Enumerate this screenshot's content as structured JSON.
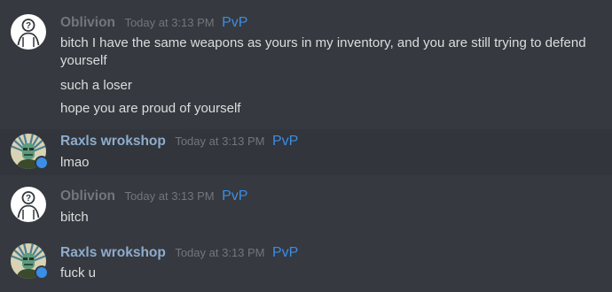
{
  "colors": {
    "background": "#36393f",
    "highlight_row": "#32353b",
    "username_oblivion": "#72767d",
    "username_raxls": "#8eaccd",
    "timestamp": "#72767d",
    "tag": "#3a8ee6",
    "message_text": "#dcddde",
    "status_dot": "#3a8ee6"
  },
  "groups": [
    {
      "username": "Oblivion",
      "timestamp": "Today at 3:13 PM",
      "tag": "PvP",
      "avatar_icon": "question-mark-person-icon",
      "lines": [
        "bitch I have the same weapons as yours in my inventory, and you are still trying to defend",
        "yourself",
        "such a loser",
        "hope you are proud of yourself"
      ]
    },
    {
      "username": "Raxls wrokshop",
      "timestamp": "Today at 3:13 PM",
      "tag": "PvP",
      "avatar_icon": "character-portrait-icon",
      "lines": [
        "lmao"
      ]
    },
    {
      "username": "Oblivion",
      "timestamp": "Today at 3:13 PM",
      "tag": "PvP",
      "avatar_icon": "question-mark-person-icon",
      "lines": [
        "bitch"
      ]
    },
    {
      "username": "Raxls wrokshop",
      "timestamp": "Today at 3:13 PM",
      "tag": "PvP",
      "avatar_icon": "character-portrait-icon",
      "lines": [
        "fuck u"
      ]
    }
  ]
}
